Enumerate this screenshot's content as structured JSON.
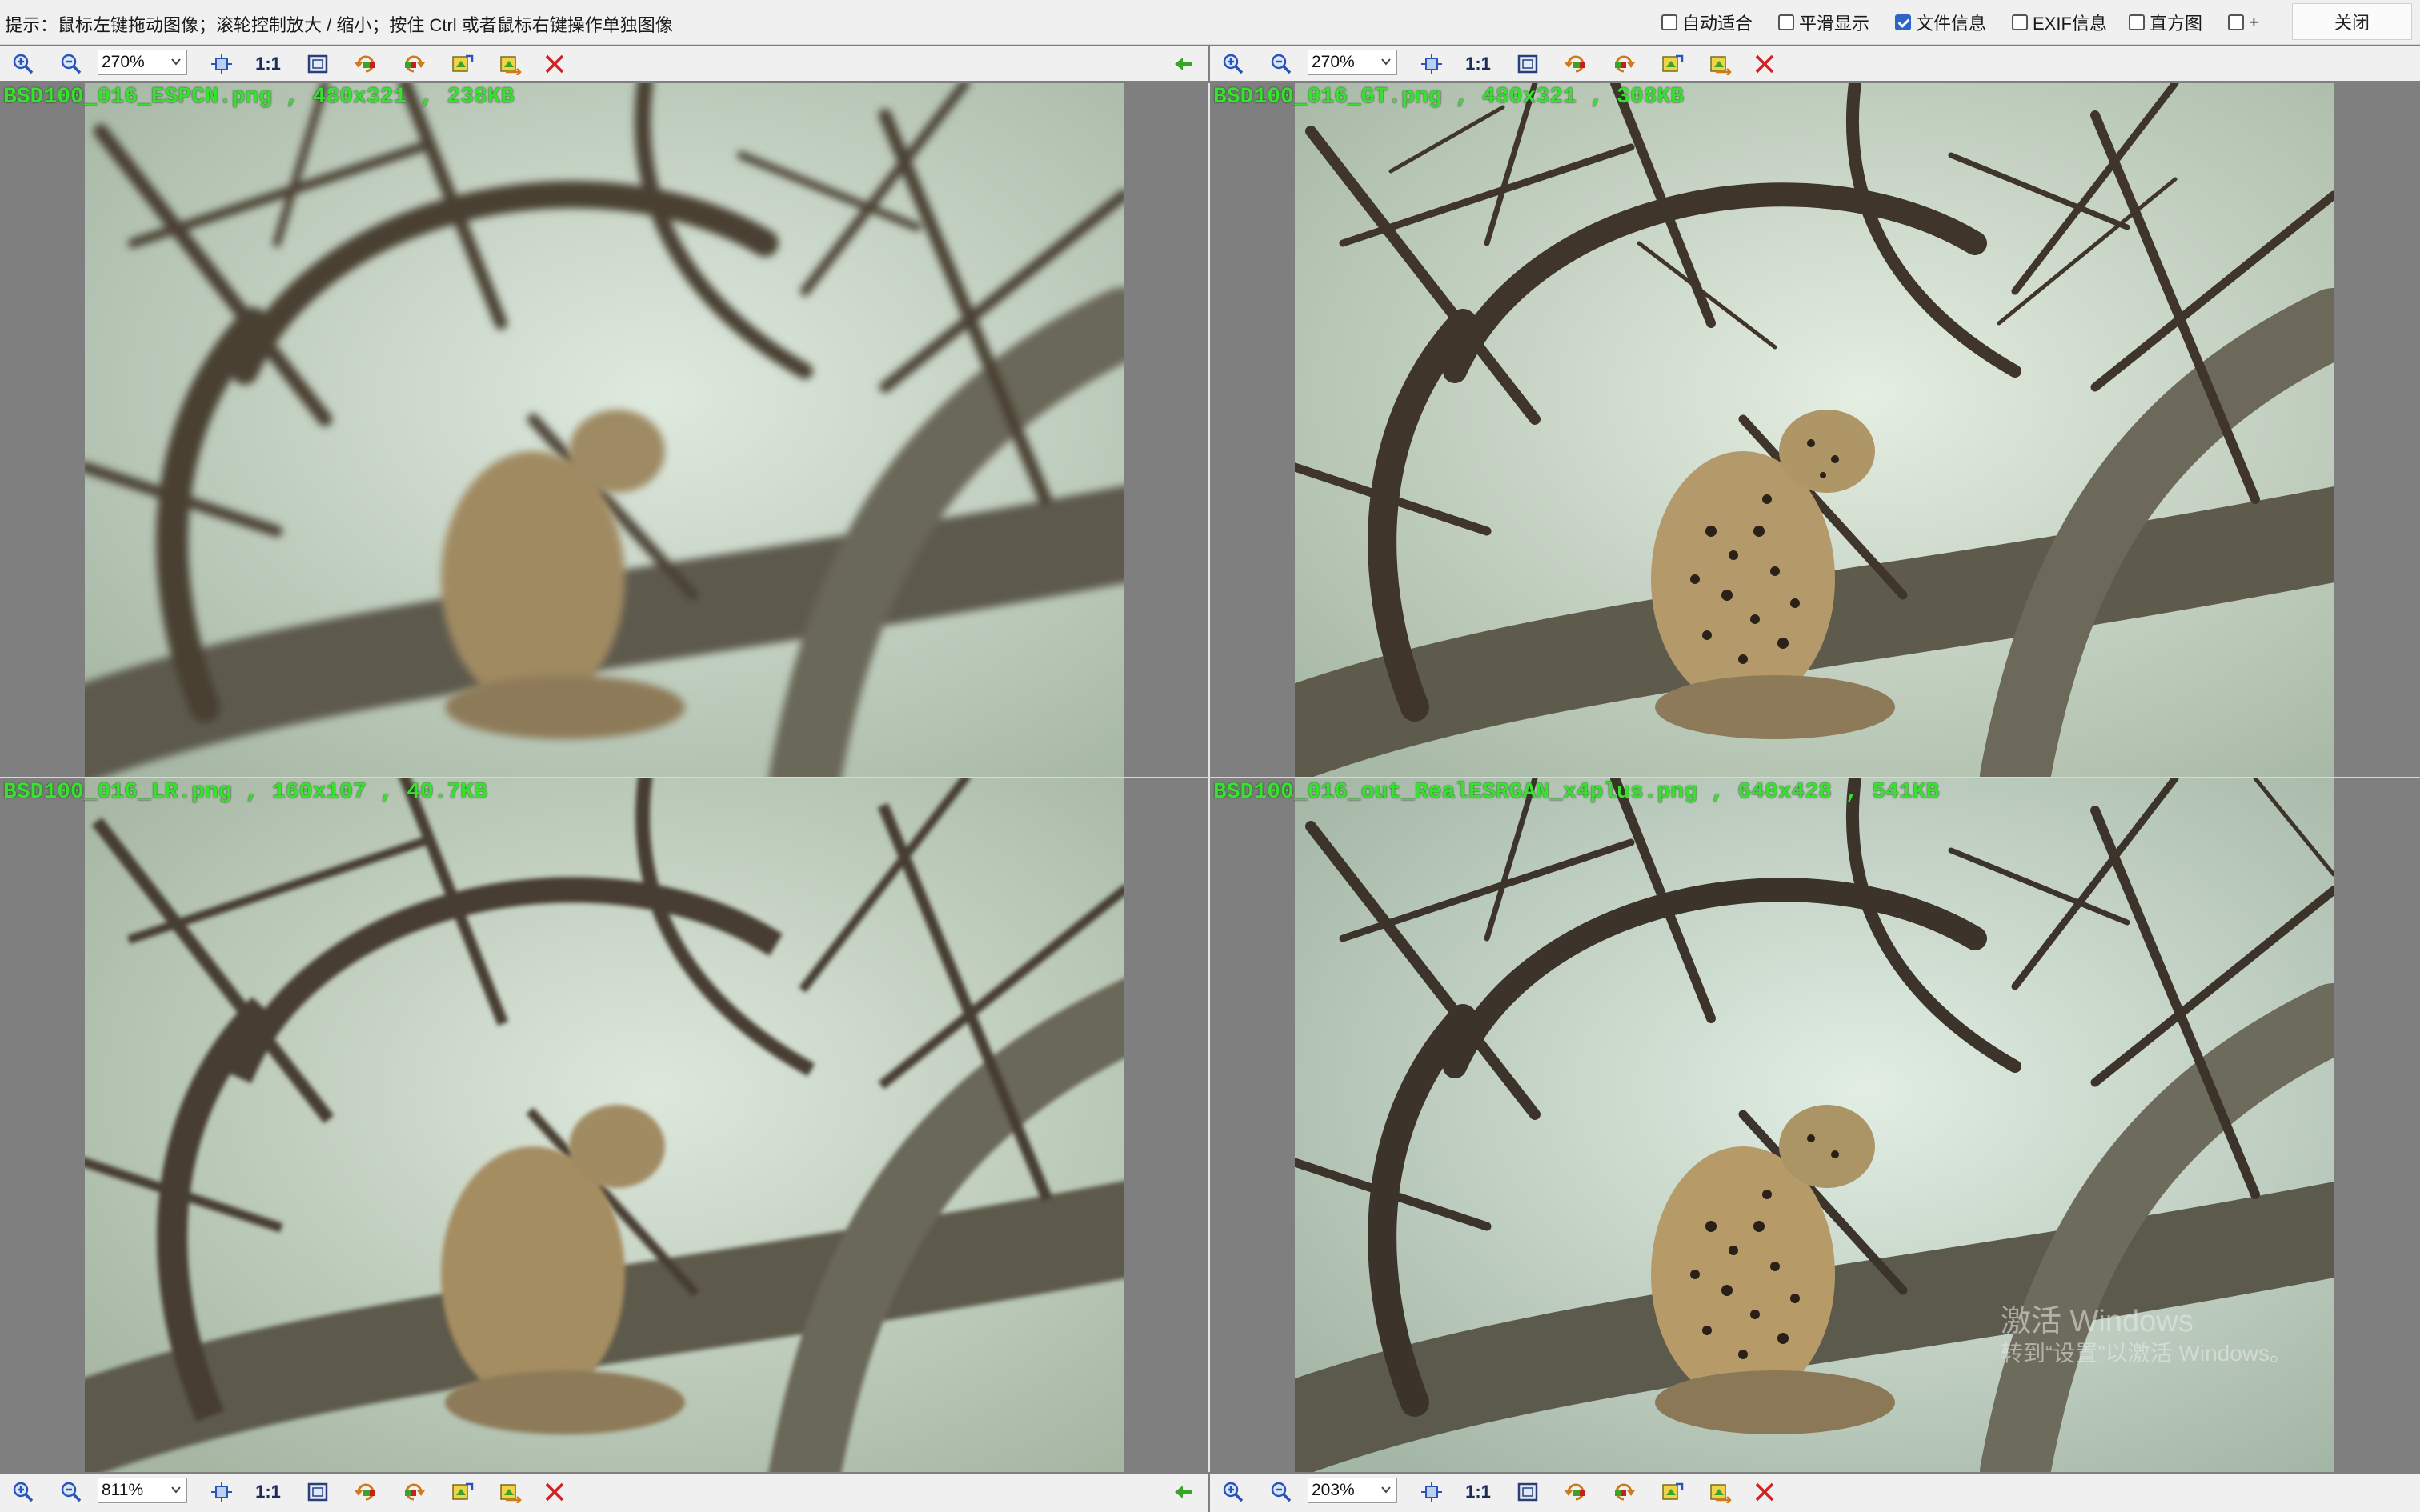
{
  "hint": "提示：鼠标左键拖动图像；滚轮控制放大 / 缩小；按住 Ctrl 或者鼠标右键操作单独图像",
  "options": [
    {
      "label": "自动适合",
      "checked": false
    },
    {
      "label": "平滑显示",
      "checked": false
    },
    {
      "label": "文件信息",
      "checked": true
    },
    {
      "label": "EXIF信息",
      "checked": false
    },
    {
      "label": "直方图",
      "checked": false
    },
    {
      "label": "+",
      "checked": false
    }
  ],
  "close_label": "关闭",
  "toolbar_labels": {
    "one_to_one": "1:1"
  },
  "panels": [
    {
      "file_info": "BSD100_016_ESPCN.png , 480x321 , 238KB",
      "zoom": "270%"
    },
    {
      "file_info": "BSD100_016_GT.png , 480x321 , 308KB",
      "zoom": "270%"
    },
    {
      "file_info": "BSD100_016_LR.png , 160x107 , 40.7KB",
      "zoom": "811%"
    },
    {
      "file_info": "BSD100_016_out_RealESRGAN_x4plus.png , 640x428 , 541KB",
      "zoom": "203%"
    }
  ],
  "watermark": {
    "line1": "激活 Windows",
    "line2": "转到“设置”以激活 Windows。"
  },
  "colors": {
    "file_info_text": "#38e030",
    "toolbar_bg": "#f0f0f0",
    "viewer_bg": "#7f7f7f",
    "close_icon": "#d42020",
    "sync_arrow": "#3aa32a"
  }
}
